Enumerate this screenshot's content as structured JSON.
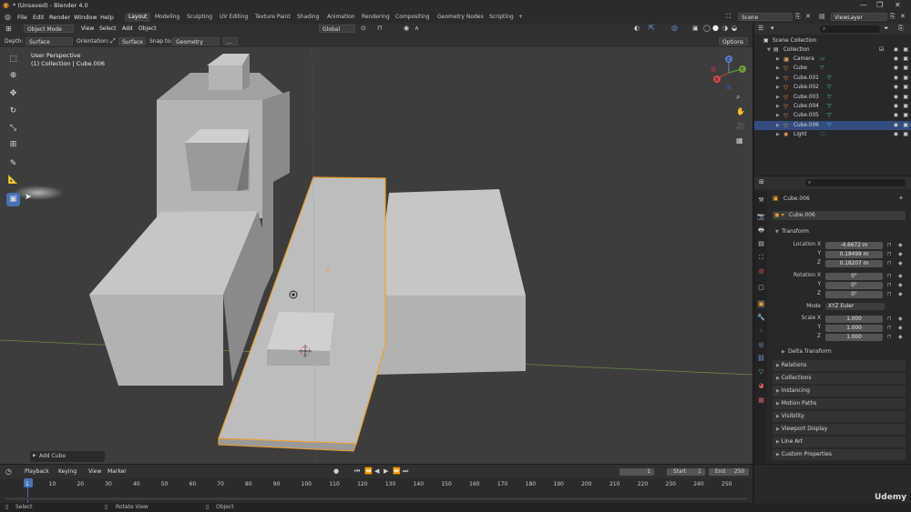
{
  "window": {
    "title": "* (Unsaved) - Blender 4.0"
  },
  "menus": [
    "File",
    "Edit",
    "Render",
    "Window",
    "Help"
  ],
  "workspaces": [
    "Layout",
    "Modeling",
    "Sculpting",
    "UV Editing",
    "Texture Paint",
    "Shading",
    "Animation",
    "Rendering",
    "Compositing",
    "Geometry Nodes",
    "Scripting"
  ],
  "workspace_add": "+",
  "scene": {
    "label": "Scene",
    "view_layer": "ViewLayer"
  },
  "viewport_header": {
    "mode": "Object Mode",
    "menus": [
      "View",
      "Select",
      "Add",
      "Object"
    ],
    "transform_orientation": "Global",
    "options": "Options"
  },
  "tool_settings": {
    "depth_label": "Depth:",
    "depth_value": "Surface",
    "orientation_label": "Orientation:",
    "orientation_value": "Surface",
    "snap_label": "Snap to:",
    "snap_value": "Geometry",
    "more": "..."
  },
  "viewport": {
    "perspective": "User Perspective",
    "collection_info": "(1) Collection | Cube.006",
    "last_op": "Add Cube",
    "axes": {
      "x": "X",
      "y": "Y",
      "z": "Z"
    }
  },
  "outliner": {
    "root": "Scene Collection",
    "collection": "Collection",
    "items": [
      {
        "name": "Camera",
        "icon": "camera-icon"
      },
      {
        "name": "Cube",
        "icon": "mesh-icon"
      },
      {
        "name": "Cube.001",
        "icon": "mesh-icon"
      },
      {
        "name": "Cube.002",
        "icon": "mesh-icon"
      },
      {
        "name": "Cube.003",
        "icon": "mesh-icon"
      },
      {
        "name": "Cube.004",
        "icon": "mesh-icon"
      },
      {
        "name": "Cube.005",
        "icon": "mesh-icon"
      },
      {
        "name": "Cube.006",
        "icon": "mesh-icon",
        "selected": true
      },
      {
        "name": "Light",
        "icon": "light-icon"
      }
    ]
  },
  "properties": {
    "object_name": "Cube.006",
    "datablock": "Cube.006",
    "transform_title": "Transform",
    "location_label": "Location X",
    "location": [
      "-4.6672 m",
      "0.18499 m",
      "0.18207 m"
    ],
    "rotation_label": "Rotation X",
    "rotation": [
      "0°",
      "0°",
      "0°"
    ],
    "mode_label": "Mode",
    "mode_value": "XYZ Euler",
    "scale_label": "Scale X",
    "scale": [
      "1.000",
      "1.000",
      "1.000"
    ],
    "axis_y": "Y",
    "axis_z": "Z",
    "delta": "Delta Transform",
    "panels": [
      "Relations",
      "Collections",
      "Instancing",
      "Motion Paths",
      "Visibility",
      "Viewport Display",
      "Line Art",
      "Custom Properties"
    ]
  },
  "timeline": {
    "menus": [
      "Playback",
      "Keying",
      "View",
      "Marker"
    ],
    "current_frame": "1",
    "start_label": "Start",
    "start": "1",
    "end_label": "End",
    "end": "250",
    "ticks": [
      "1",
      "10",
      "20",
      "30",
      "40",
      "50",
      "60",
      "70",
      "80",
      "90",
      "100",
      "110",
      "120",
      "130",
      "140",
      "150",
      "160",
      "170",
      "180",
      "190",
      "200",
      "210",
      "220",
      "230",
      "240",
      "250"
    ]
  },
  "statusbar": {
    "select": "Select",
    "rotate": "Rotate View",
    "object": "Object"
  },
  "watermark": "Udemy",
  "colors": {
    "accent": "#4772b3",
    "selection_outline": "#f0a030",
    "viewport_bg": "#3d3d3d"
  }
}
